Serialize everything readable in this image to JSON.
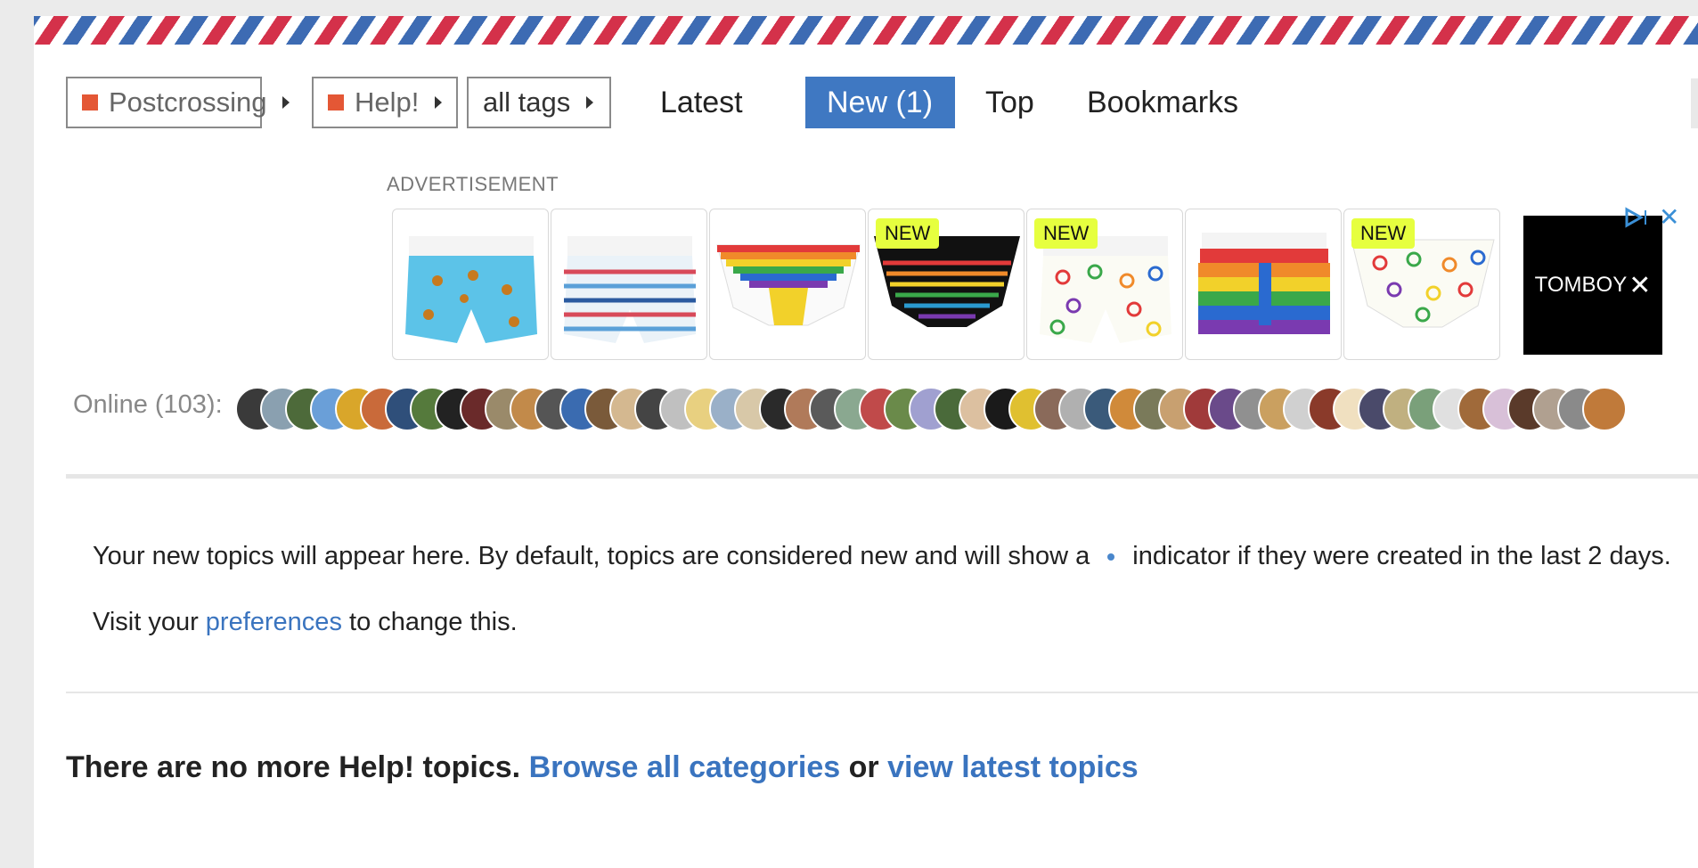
{
  "nav": {
    "category_dropdown": "Postcrossing",
    "subcategory_dropdown": "Help!",
    "tags_dropdown": "all tags",
    "tabs": [
      {
        "label": "Latest",
        "active": false
      },
      {
        "label": "New (1)",
        "active": true
      },
      {
        "label": "Top",
        "active": false
      },
      {
        "label": "Bookmarks",
        "active": false
      }
    ]
  },
  "ad": {
    "label": "ADVERTISEMENT",
    "badge": "NEW",
    "brand": "TOMBOY",
    "brand_close": "✕"
  },
  "online": {
    "label": "Online (103):",
    "avatar_colors": [
      "#3a3a3a",
      "#8aa0b0",
      "#4d6a3a",
      "#6a9fd8",
      "#d9a62a",
      "#c96a3a",
      "#2f4f7a",
      "#557a3c",
      "#222222",
      "#6a2a2a",
      "#9a8a6a",
      "#c28a4a",
      "#555555",
      "#3a6bb0",
      "#7a5a3a",
      "#d4b890",
      "#444444",
      "#c0c0c0",
      "#e8d080",
      "#9ab0c8",
      "#d8c8a8",
      "#2a2a2a",
      "#b07a5a",
      "#5a5a5a",
      "#8aa890",
      "#c04a4a",
      "#6a8a4a",
      "#a0a0d0",
      "#4a6a3a",
      "#dcc0a0",
      "#1a1a1a",
      "#e0c030",
      "#8a6a5a",
      "#b0b0b0",
      "#3a5a7a",
      "#d08a3a",
      "#7a7a5a",
      "#c8a070",
      "#a03a3a",
      "#6a4a8a",
      "#909090",
      "#caa060",
      "#d0d0d0",
      "#8a3a2a",
      "#f0e0c0",
      "#4a4a6a",
      "#c0b080",
      "#7aa07a",
      "#e0e0e0",
      "#a06a3a",
      "#d8c0d8",
      "#5a3a2a",
      "#b0a090",
      "#8a8a8a",
      "#c07a3a"
    ]
  },
  "new_topics": {
    "line1": "Your new topics will appear here. By default, topics are considered new and will show a",
    "line1_tail": "indicator if they were created in the last 2 days.",
    "line2_prefix": "Visit your",
    "line2_link": "preferences",
    "line2_suffix": "to change this."
  },
  "footer": {
    "text": "There are no more Help! topics.",
    "link1": "Browse all categories",
    "or": "or",
    "link2": "view latest topics"
  },
  "colors": {
    "accent": "#3f78c2",
    "category": "#e45735",
    "new_badge": "#e6ff3f"
  }
}
